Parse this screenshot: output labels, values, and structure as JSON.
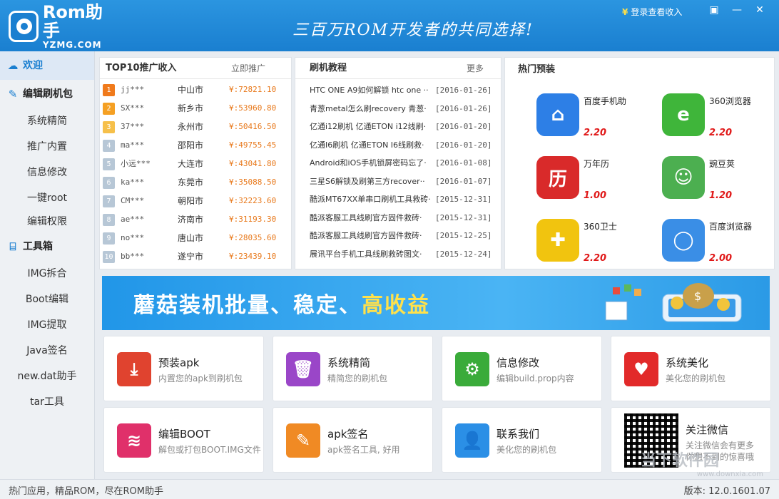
{
  "titlebar": {
    "logo_main": "Rom助手",
    "logo_sub": "YZMG.COM",
    "slogan": "三百万ROM开发者的共同选择!",
    "login_label": "登录查看收入",
    "login_icon": "yen-icon",
    "window_buttons": [
      "skin-icon",
      "minimize-icon",
      "close-icon"
    ]
  },
  "sidebar": {
    "welcome": "欢迎",
    "section_edit": "编辑刷机包",
    "edit_items": [
      "系统精简",
      "推广内置",
      "信息修改",
      "一键root",
      "编辑权限"
    ],
    "section_tools": "工具箱",
    "tool_items": [
      "IMG拆合",
      "Boot编辑",
      "IMG提取",
      "Java签名",
      "new.dat助手",
      "tar工具"
    ]
  },
  "top10": {
    "title": "TOP10推广收入",
    "action": "立即推广",
    "rows": [
      {
        "rank": "1",
        "user": "jj***",
        "city": "中山市",
        "amount": "¥:72821.10",
        "color": "#f07a1b"
      },
      {
        "rank": "2",
        "user": "SX***",
        "city": "新乡市",
        "amount": "¥:53960.80",
        "color": "#f5a023"
      },
      {
        "rank": "3",
        "user": "37***",
        "city": "永州市",
        "amount": "¥:50416.50",
        "color": "#f6c04a"
      },
      {
        "rank": "4",
        "user": "ma***",
        "city": "邵阳市",
        "amount": "¥:49755.45",
        "color": "#b7c7d6"
      },
      {
        "rank": "5",
        "user": "小远***",
        "city": "大连市",
        "amount": "¥:43041.80",
        "color": "#b7c7d6"
      },
      {
        "rank": "6",
        "user": "ka***",
        "city": "东莞市",
        "amount": "¥:35088.50",
        "color": "#b7c7d6"
      },
      {
        "rank": "7",
        "user": "CM***",
        "city": "朝阳市",
        "amount": "¥:32223.60",
        "color": "#b7c7d6"
      },
      {
        "rank": "8",
        "user": "ae***",
        "city": "济南市",
        "amount": "¥:31193.30",
        "color": "#b7c7d6"
      },
      {
        "rank": "9",
        "user": "no***",
        "city": "唐山市",
        "amount": "¥:28035.60",
        "color": "#b7c7d6"
      },
      {
        "rank": "10",
        "user": "bb***",
        "city": "遂宁市",
        "amount": "¥:23439.10",
        "color": "#b7c7d6"
      }
    ]
  },
  "tutorials": {
    "title": "刷机教程",
    "more": "更多",
    "rows": [
      {
        "title": "HTC ONE A9如何解锁 htc one ··",
        "date": "[2016-01-26]"
      },
      {
        "title": "青葱metal怎么刷recovery 青葱·",
        "date": "[2016-01-26]"
      },
      {
        "title": "亿通i12刷机 亿通ETON i12线刷·",
        "date": "[2016-01-20]"
      },
      {
        "title": "亿通I6刷机 亿通ETON I6线刷救·",
        "date": "[2016-01-20]"
      },
      {
        "title": "Android和iOS手机锁屏密码忘了·",
        "date": "[2016-01-08]"
      },
      {
        "title": "三星S6解锁及刷第三方recover··",
        "date": "[2016-01-07]"
      },
      {
        "title": "酷派MT67XX单串口刷机工具救砖·",
        "date": "[2015-12-31]"
      },
      {
        "title": "酷派客服工具线刷官方固件救砖·",
        "date": "[2015-12-31]"
      },
      {
        "title": "酷派客服工具线刷官方固件救砖·",
        "date": "[2015-12-25]"
      },
      {
        "title": "展讯平台手机工具线刷救砖图文·",
        "date": "[2015-12-24]"
      }
    ]
  },
  "hot_apps": {
    "title": "热门预装",
    "apps": [
      {
        "name": "百度手机助",
        "score": "2.20",
        "icon": "baidu-assistant-icon",
        "color": "#2d7fe6",
        "glyph": "⌂"
      },
      {
        "name": "360浏览器",
        "score": "2.20",
        "icon": "360-browser-icon",
        "color": "#3fb53a",
        "glyph": "e"
      },
      {
        "name": "万年历",
        "score": "1.00",
        "icon": "calendar-icon",
        "color": "#d92a2a",
        "glyph": "历"
      },
      {
        "name": "豌豆荚",
        "score": "1.20",
        "icon": "wandoujia-icon",
        "color": "#4caf50",
        "glyph": "☺"
      },
      {
        "name": "360卫士",
        "score": "2.20",
        "icon": "360-security-icon",
        "color": "#f1c40f",
        "glyph": "✚"
      },
      {
        "name": "百度浏览器",
        "score": "2.00",
        "icon": "baidu-browser-icon",
        "color": "#3a8ee6",
        "glyph": "◯"
      }
    ]
  },
  "banner": {
    "text_main": "蘑菇装机批量、稳定、",
    "text_highlight": "高收益"
  },
  "cards": [
    {
      "title": "预装apk",
      "desc": "内置您的apk到刷机包",
      "icon": "download-icon",
      "color": "#e0432f",
      "glyph": "⤓"
    },
    {
      "title": "系统精简",
      "desc": "精简您的刷机包",
      "icon": "trash-icon",
      "color": "#9a46c8",
      "glyph": "🗑"
    },
    {
      "title": "信息修改",
      "desc": "编辑build.prop内容",
      "icon": "gear-icon",
      "color": "#3aab3a",
      "glyph": "⚙"
    },
    {
      "title": "系统美化",
      "desc": "美化您的刷机包",
      "icon": "heart-icon",
      "color": "#e22a2a",
      "glyph": "♥"
    },
    {
      "title": "编辑BOOT",
      "desc": "解包或打包BOOT.IMG文件",
      "icon": "layers-icon",
      "color": "#e0306a",
      "glyph": "≋"
    },
    {
      "title": "apk签名",
      "desc": "apk签名工具, 好用",
      "icon": "pencil-icon",
      "color": "#f08a24",
      "glyph": "✎"
    },
    {
      "title": "联系我们",
      "desc": "美化您的刷机包",
      "icon": "user-icon",
      "color": "#2b8fe6",
      "glyph": "👤"
    }
  ],
  "wechat": {
    "title": "关注微信",
    "desc_line1": "关注微信会有更多",
    "desc_line2": "你想不到的惊喜哦"
  },
  "statusbar": {
    "left": "热门应用，精品ROM，尽在ROM助手",
    "right": "版本: 12.0.1601.07"
  },
  "watermark": {
    "main": "当下软件园",
    "sub": "www.downxia.com"
  }
}
